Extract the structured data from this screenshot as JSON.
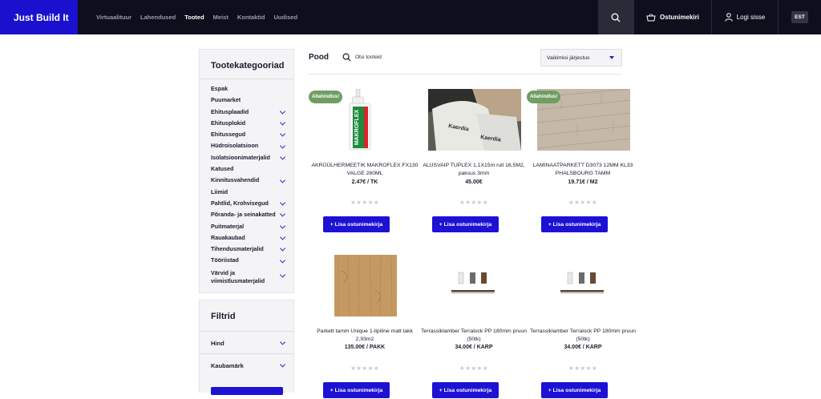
{
  "header": {
    "logo": "Just Build It",
    "nav": [
      "Virtuaalituur",
      "Lahendused",
      "Tooted",
      "Meist",
      "Kontaktid",
      "Uudised"
    ],
    "active_nav": "Tooted",
    "cart_label": "Ostunimekiri",
    "login_label": "Logi sisse",
    "lang": "EST"
  },
  "sidebar": {
    "categories_title": "Tootekategooriad",
    "categories": [
      {
        "label": "Espak",
        "expandable": false
      },
      {
        "label": "Puumarket",
        "expandable": false
      },
      {
        "label": "Ehitusplaadid",
        "expandable": true
      },
      {
        "label": "Ehitusplokid",
        "expandable": true
      },
      {
        "label": "Ehitussegud",
        "expandable": true
      },
      {
        "label": "Hüdroisolatsioon",
        "expandable": true
      },
      {
        "label": "Isolatsioonimaterjalid",
        "expandable": true
      },
      {
        "label": "Katused",
        "expandable": false
      },
      {
        "label": "Kinnitusvahendid",
        "expandable": true
      },
      {
        "label": "Liimid",
        "expandable": false
      },
      {
        "label": "Pahtlid, Krohvisegud",
        "expandable": true
      },
      {
        "label": "Põranda- ja seinakatted",
        "expandable": true
      },
      {
        "label": "Puitmaterjal",
        "expandable": true
      },
      {
        "label": "Rauakaubad",
        "expandable": true
      },
      {
        "label": "Tihendusmaterjalid",
        "expandable": true
      },
      {
        "label": "Tööriistad",
        "expandable": true
      },
      {
        "label": "Värvid ja viimistlusmaterjalid",
        "expandable": true
      }
    ],
    "filters_title": "Filtrid",
    "filters": [
      "Hind",
      "Kaubamärk"
    ]
  },
  "main": {
    "title": "Pood",
    "search_label": "Otsi tooteid",
    "sort_label": "Vaikimisi järjestus",
    "add_label": "+ Lisa ostunimekirja",
    "products": [
      {
        "name": "AKRÜÜLHERMEETIK MAKROFLEX FX130 VALGE 280ML",
        "price": "2.47€ / TK",
        "badge": "Allahindlus!",
        "img": "tube"
      },
      {
        "name": "ALUSVAIP TUPLEX 1,1X15m rull 16,5M2, paksus 3mm",
        "price": "45.00€",
        "badge": "",
        "img": "underlay"
      },
      {
        "name": "LAMINAATPARKETT D3073 12MM KL33 PHALSBOURG TAMM",
        "price": "19.71€ / M2",
        "badge": "Allahindlus!",
        "img": "laminate"
      },
      {
        "name": "Parkett tamm Unique 1-lipiline matt lakk 2,93m2",
        "price": "135.00€ / PAKK",
        "badge": "",
        "img": "oak"
      },
      {
        "name": "Terrassiklamber Terralock PP 180mm pruun (50tk)",
        "price": "34.00€ / KARP",
        "badge": "",
        "img": "clamp"
      },
      {
        "name": "Terrassiklamber Terralock PP 180mm pruun (50tk)",
        "price": "34.00€ / KARP",
        "badge": "",
        "img": "clamp"
      }
    ]
  },
  "colors": {
    "accent": "#1d12d4",
    "header_bg": "#0f0e1c",
    "badge": "#6f9e63"
  }
}
